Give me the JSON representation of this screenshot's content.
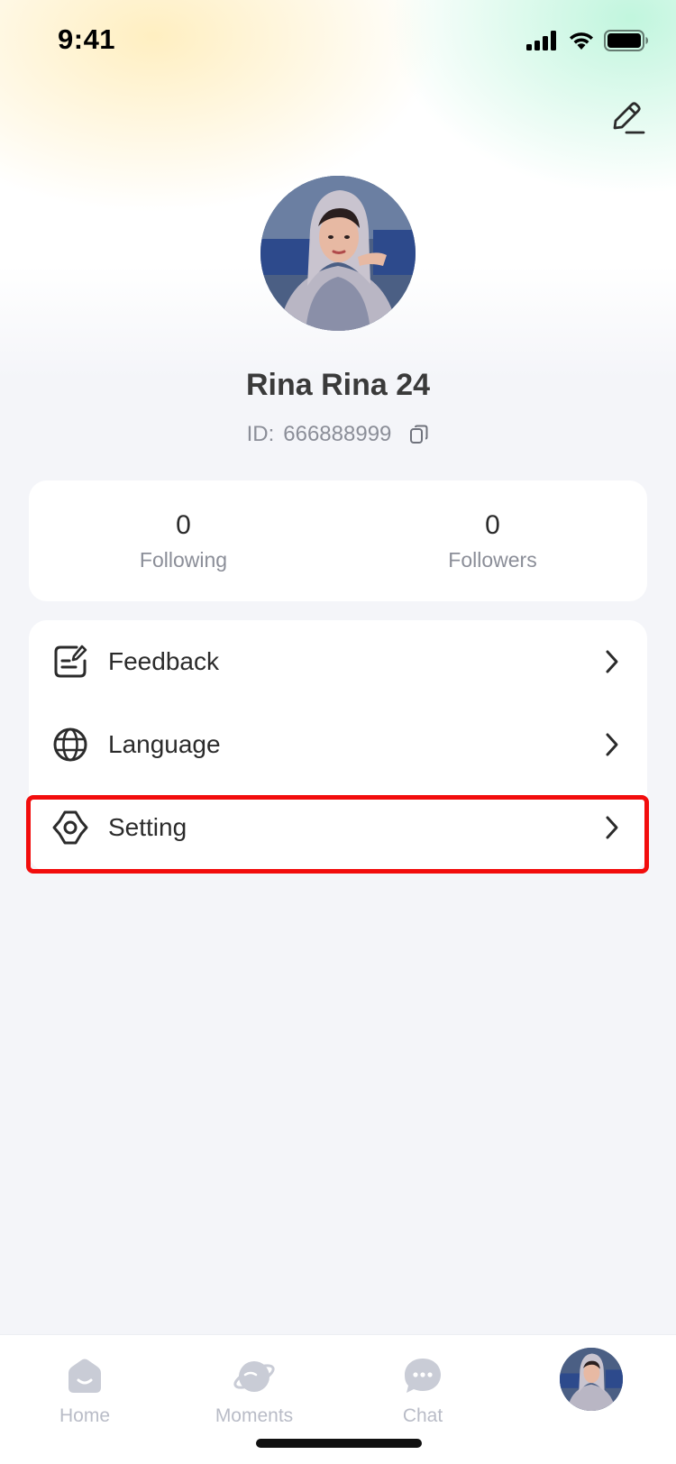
{
  "status_bar": {
    "time": "9:41"
  },
  "profile": {
    "name": "Rina Rina 24",
    "id_label": "ID:",
    "id_value": "666888999"
  },
  "stats": [
    {
      "value": "0",
      "label": "Following"
    },
    {
      "value": "0",
      "label": "Followers"
    }
  ],
  "menu": [
    {
      "label": "Feedback",
      "icon": "feedback-icon"
    },
    {
      "label": "Language",
      "icon": "globe-icon"
    },
    {
      "label": "Setting",
      "icon": "gear-icon"
    }
  ],
  "tabs": [
    {
      "label": "Home",
      "icon": "home-icon"
    },
    {
      "label": "Moments",
      "icon": "planet-icon"
    },
    {
      "label": "Chat",
      "icon": "chat-bubble-icon"
    },
    {
      "label": "",
      "icon": "profile-avatar"
    }
  ],
  "colors": {
    "highlight": "#f20d0d",
    "tab_inactive": "#b9bcc7",
    "background": "#f4f5f9"
  }
}
